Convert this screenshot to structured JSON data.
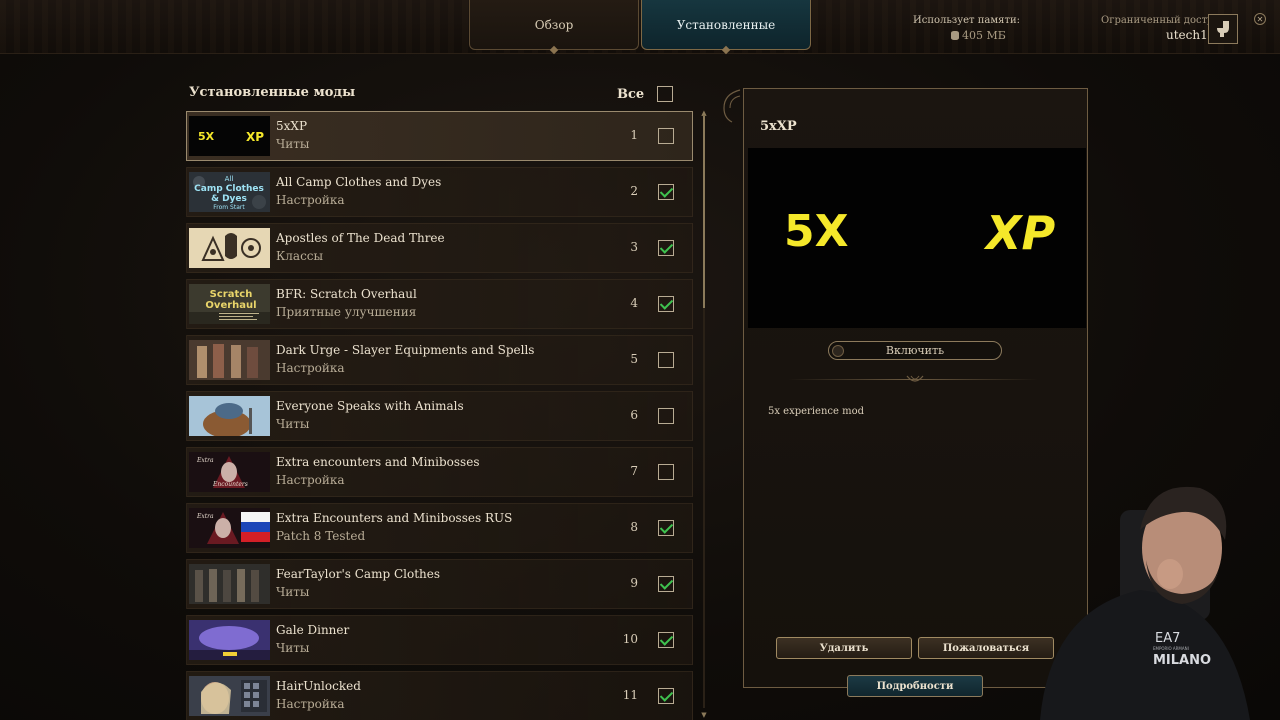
{
  "top_bar": {
    "tabs": [
      {
        "label": "Обзор",
        "active": false
      },
      {
        "label": "Установленные",
        "active": true
      }
    ],
    "memory_label": "Использует памяти:",
    "memory_value": "405 МБ",
    "access_label": "Ограниченный доступ",
    "username": "utech1"
  },
  "mod_list": {
    "title": "Установленные моды",
    "select_all_label": "Все",
    "select_all_checked": false,
    "items": [
      {
        "name": "5xXP",
        "category": "Читы",
        "order": "1",
        "enabled": false,
        "selected": true,
        "thumb": "5xxp"
      },
      {
        "name": "All Camp Clothes and Dyes",
        "category": "Настройка",
        "order": "2",
        "enabled": true,
        "selected": false,
        "thumb": "camp-clothes"
      },
      {
        "name": "Apostles of The Dead Three",
        "category": "Классы",
        "order": "3",
        "enabled": true,
        "selected": false,
        "thumb": "apostles"
      },
      {
        "name": "BFR: Scratch Overhaul",
        "category": "Приятные улучшения",
        "order": "4",
        "enabled": true,
        "selected": false,
        "thumb": "scratch"
      },
      {
        "name": "Dark Urge - Slayer Equipments and Spells",
        "category": "Настройка",
        "order": "5",
        "enabled": false,
        "selected": false,
        "thumb": "dark-urge"
      },
      {
        "name": "Everyone Speaks with Animals",
        "category": "Читы",
        "order": "6",
        "enabled": false,
        "selected": false,
        "thumb": "animals"
      },
      {
        "name": "Extra encounters and Minibosses",
        "category": "Настройка",
        "order": "7",
        "enabled": false,
        "selected": false,
        "thumb": "extra"
      },
      {
        "name": "Extra Encounters and Minibosses RUS",
        "category": "Patch 8 Tested",
        "order": "8",
        "enabled": true,
        "selected": false,
        "thumb": "extra-rus"
      },
      {
        "name": "FearTaylor's Camp Clothes",
        "category": "Читы",
        "order": "9",
        "enabled": true,
        "selected": false,
        "thumb": "feartaylor"
      },
      {
        "name": "Gale Dinner",
        "category": "Читы",
        "order": "10",
        "enabled": true,
        "selected": false,
        "thumb": "gale"
      },
      {
        "name": "HairUnlocked",
        "category": "Настройка",
        "order": "11",
        "enabled": true,
        "selected": false,
        "thumb": "hair"
      }
    ]
  },
  "detail": {
    "title": "5xXP",
    "preview_left": "5X",
    "preview_right": "XP",
    "toggle_label": "Включить",
    "description": "5x experience mod",
    "delete_label": "Удалить",
    "report_label": "Пожаловаться",
    "details_label": "Подробности"
  },
  "thumb_text": {
    "5xxp_left": "5X",
    "5xxp_right": "XP",
    "camp_l1": "All",
    "camp_l2": "Camp Clothes",
    "camp_l3": "& Dyes",
    "camp_l4": "From Start",
    "scratch_l1": "Scratch",
    "scratch_l2": "Overhaul",
    "extra_l1": "Extra",
    "extra_l2": "Encounters"
  },
  "webcam_badge": {
    "l1": "EA7",
    "l2": "EMPORIO ARMANI",
    "l3": "MILANO"
  },
  "colors": {
    "accent_gold": "#a08a62",
    "check_green": "#3fc24f",
    "active_tab": "#16363f",
    "preview_yellow": "#f5e82a"
  }
}
